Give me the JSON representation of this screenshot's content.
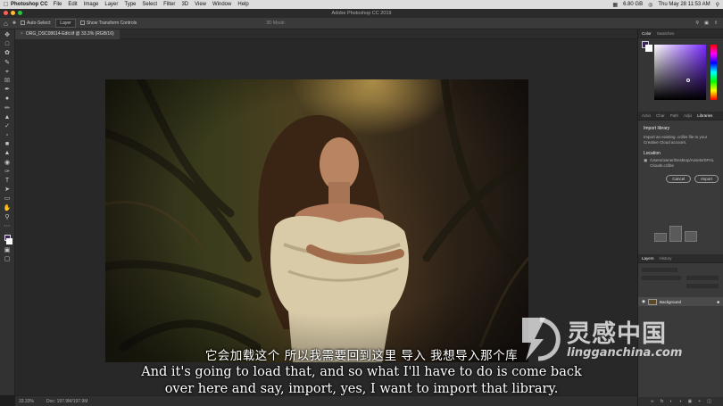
{
  "menubar": {
    "app_name": "Photoshop CC",
    "items": [
      "File",
      "Edit",
      "Image",
      "Layer",
      "Type",
      "Select",
      "Filter",
      "3D",
      "View",
      "Window",
      "Help"
    ],
    "battery": "6.80 GB",
    "datetime": "Thu May 28  11:53 AM"
  },
  "window": {
    "title": "Adobe Photoshop CC 2019"
  },
  "options_bar": {
    "auto_select": "Auto-Select:",
    "auto_select_value": "Layer",
    "show_transform": "Show Transform Controls",
    "mode_3d": "3D Mode:"
  },
  "document": {
    "tab_label": "ORG_DSC08614-Edit.tif @ 33.3% (RGB/16)"
  },
  "status_bar": {
    "zoom": "33.33%",
    "doc_size": "Doc: 197.9M/197.9M"
  },
  "panels": {
    "color_tabs": [
      "Color",
      "Swatches"
    ],
    "colors": {
      "foreground": "#3b2458",
      "background": "#ffffff"
    },
    "library_tabs": [
      "Actio",
      "Char",
      "Path",
      "Adju",
      "Libraries"
    ],
    "import_library": {
      "title": "Import library",
      "description": "Import an existing .cclibs file to your Creative Cloud account.",
      "location_label": "Location",
      "location_path": "/Users/owner/Desktop/Assets/SFHL Clouds.cclibs",
      "cancel": "Cancel",
      "import": "Import"
    },
    "layers_tabs": [
      "Layers",
      "History"
    ],
    "layer_name": "Background"
  },
  "subtitles": {
    "chinese": "它会加载这个 所以我需要回到这里 导入 我想导入那个库",
    "english_line1": "And it's going to load that, and so what I'll have to do is come back",
    "english_line2": "over here and say, import, yes, I want to import that library."
  },
  "watermark": {
    "chinese": "灵感中国",
    "url": "lingganchina.com"
  }
}
